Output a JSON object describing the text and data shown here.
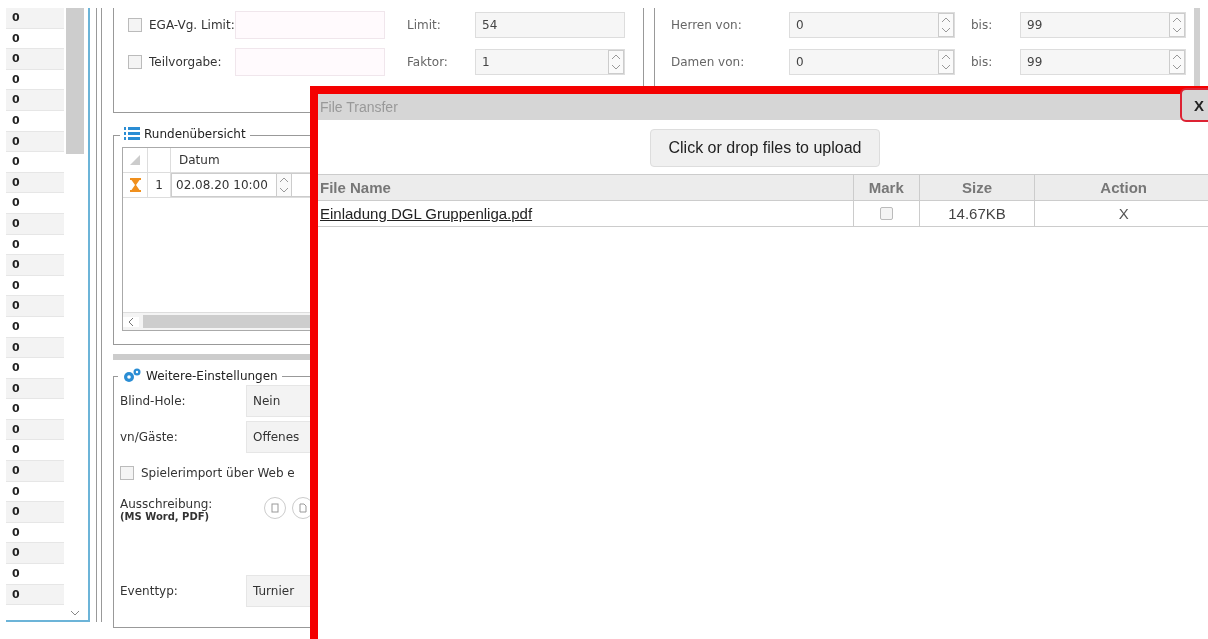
{
  "left_list": {
    "rows": [
      "0",
      "0",
      "0",
      "0",
      "0",
      "0",
      "0",
      "0",
      "0",
      "0",
      "0",
      "0",
      "0",
      "0",
      "0",
      "0",
      "0",
      "0",
      "0",
      "0",
      "0",
      "0",
      "0",
      "0",
      "0",
      "0",
      "0",
      "0",
      "0"
    ]
  },
  "general": {
    "checkboxes": [
      {
        "label": "EGA-Vg. Limit:",
        "checked": false
      },
      {
        "label": "Teilvorgabe:",
        "checked": false
      }
    ],
    "fields": [
      {
        "label": "Limit:",
        "value": "54",
        "kind": "text"
      },
      {
        "label": "Faktor:",
        "value": "1",
        "kind": "spin"
      }
    ]
  },
  "age_ranges": [
    {
      "label": "Herren von:",
      "from": "0",
      "to_label": "bis:",
      "to": "99"
    },
    {
      "label": "Damen von:",
      "from": "0",
      "to_label": "bis:",
      "to": "99"
    }
  ],
  "rounds": {
    "title": "Rundenübersicht",
    "columns": [
      "Datum"
    ],
    "rows": [
      {
        "number": "1",
        "date": "02.08.20 10:00"
      }
    ]
  },
  "settings": {
    "title": "Weitere-Einstellungen",
    "rows": [
      {
        "kind": "select",
        "label": "Blind-Hole:",
        "value": "Nein"
      },
      {
        "kind": "select",
        "label": "vn/Gäste:",
        "value": "Offenes"
      },
      {
        "kind": "checkbox",
        "label": "Spielerimport über Web e",
        "checked": false
      },
      {
        "kind": "files",
        "label": "Ausschreibung:",
        "note": "(MS Word, PDF)"
      },
      {
        "kind": "select",
        "label": "Eventtyp:",
        "value": "Turnier"
      }
    ]
  },
  "dialog": {
    "title": "File Transfer",
    "close": "X",
    "upload_button": "Click or drop files to upload",
    "columns": [
      "File Name",
      "Mark",
      "Size",
      "Action"
    ],
    "files": [
      {
        "name": "Einladung DGL Gruppenliga.pdf",
        "marked": false,
        "size": "14.67KB",
        "action": "X"
      }
    ]
  }
}
